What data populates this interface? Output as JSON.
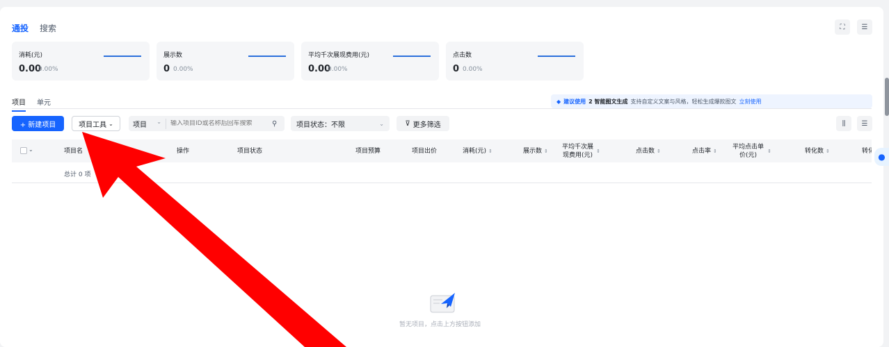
{
  "top_tabs": [
    {
      "label": "通投",
      "active": true
    },
    {
      "label": "搜索",
      "active": false
    }
  ],
  "icons": {
    "fullscreen": "fullscreen-icon",
    "settings": "settings-icon",
    "columns": "columns-icon",
    "filter_settings": "filter-settings-icon"
  },
  "metrics": [
    {
      "label": "消耗(元)",
      "value": "0.00",
      "percent": "0.00%"
    },
    {
      "label": "展示数",
      "value": "0",
      "percent": "0.00%"
    },
    {
      "label": "平均千次展现费用(元)",
      "value": "0.00",
      "percent": "0.00%"
    },
    {
      "label": "点击数",
      "value": "0",
      "percent": "0.00%"
    }
  ],
  "sub_tabs": [
    {
      "label": "项目",
      "active": true
    },
    {
      "label": "单元",
      "active": false
    }
  ],
  "promo": {
    "title": "建议使用",
    "name": "2 智能图文生成",
    "desc": "支持自定义文案与风格，轻松生成爆款图文",
    "link": "立刻使用"
  },
  "toolbar": {
    "new_project": "+ 新建项目",
    "project_tools": "项目工具",
    "search_type": "项目",
    "search_placeholder": "输入项目ID或名称后回车搜索",
    "status_label": "项目状态：",
    "status_value": "不限",
    "more_filter": "更多筛选"
  },
  "table": {
    "columns": [
      "项目名",
      "操作",
      "项目状态",
      "项目预算",
      "项目出价",
      "消耗(元)",
      "展示数",
      "平均千次展现费用(元)",
      "点击数",
      "点击率",
      "平均点击单价(元)",
      "转化数",
      "转化"
    ],
    "total": "总计 0 项"
  },
  "empty": {
    "text": "暂无项目，点击上方按钮添加"
  },
  "colors": {
    "accent": "#1664ff",
    "arrow": "#ff0000"
  }
}
